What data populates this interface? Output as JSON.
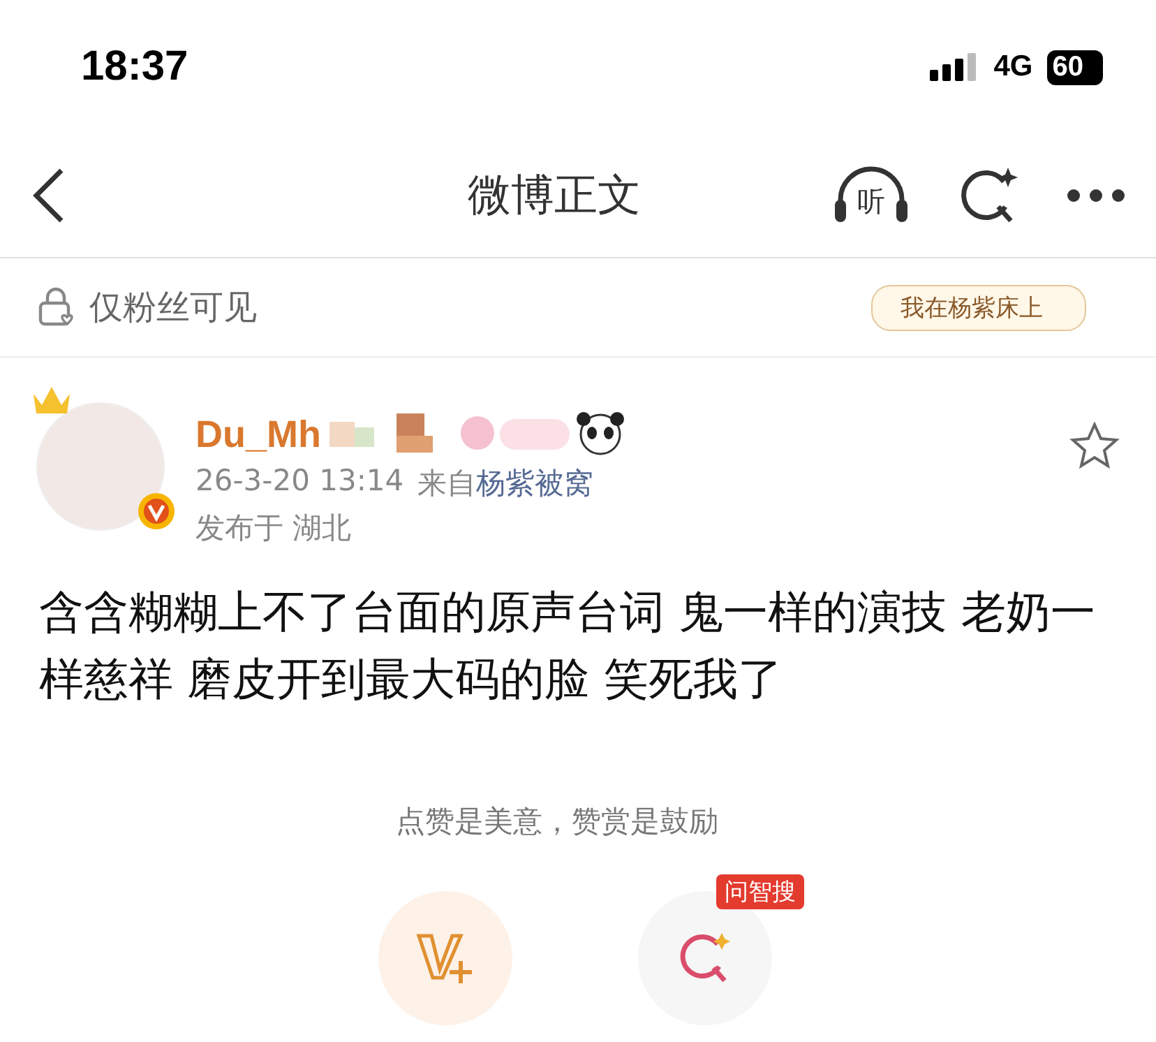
{
  "status_bar": {
    "time": "18:37",
    "network": "4G",
    "battery": "60"
  },
  "nav": {
    "title": "微博正文",
    "listen_label": "听"
  },
  "visibility": {
    "label": "仅粉丝可见",
    "sticker": "我在杨紫床上"
  },
  "post": {
    "author": "Du_Mh",
    "starred": false,
    "time": "26-3-20 13:14",
    "source_prefix": "来自",
    "source": "杨紫被窝",
    "location": "发布于 湖北",
    "text": "含含糊糊上不了台面的原声台词 鬼一样的演技 老奶一样慈祥 磨皮开到最大码的脸 笑死我了"
  },
  "reward": {
    "tip": "点赞是美意，赞赏是鼓励",
    "badge": "问智搜"
  }
}
